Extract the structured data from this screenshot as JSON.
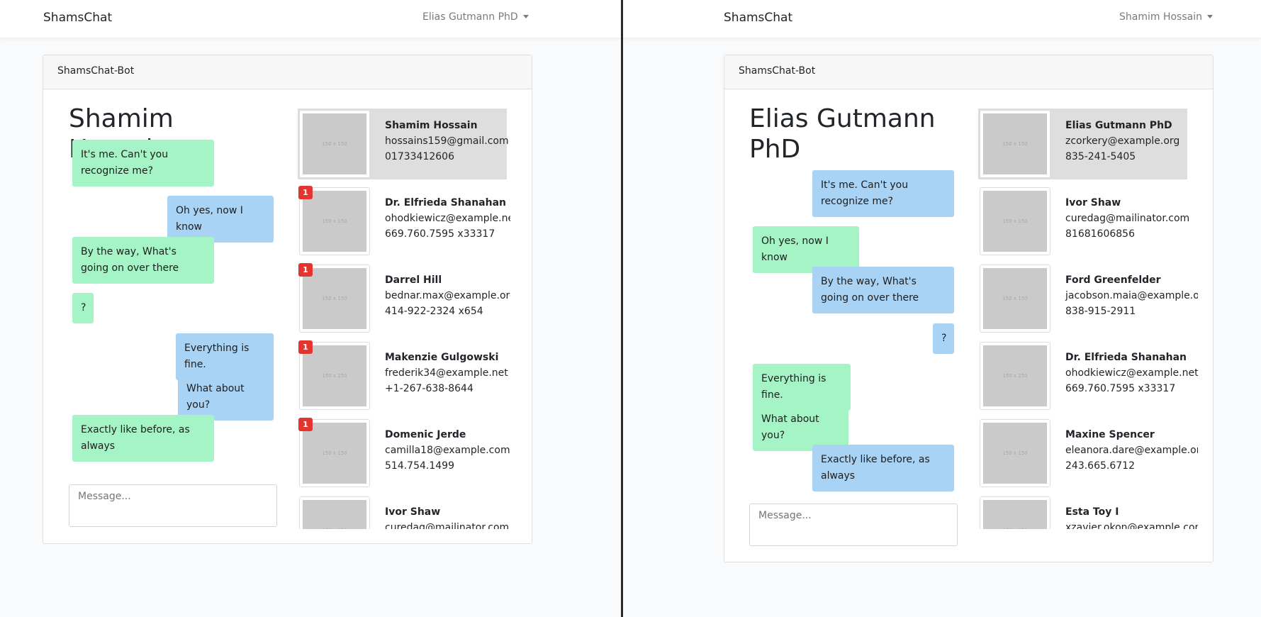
{
  "left": {
    "brand": "ShamsChat",
    "current_user": "Elias Gutmann PhD",
    "card_title": "ShamsChat-Bot",
    "chat_partner": "Shamim Hossain",
    "messages": [
      {
        "text": "It's me. Can't you recognize me?",
        "side": "left",
        "color": "green"
      },
      {
        "text": "Oh yes, now I know",
        "side": "right",
        "color": "blue"
      },
      {
        "text": "By the way, What's going on over there",
        "side": "left",
        "color": "green"
      },
      {
        "text": "?",
        "side": "left",
        "color": "green"
      },
      {
        "text": "Everything is fine.",
        "side": "right",
        "color": "blue"
      },
      {
        "text": "What about you?",
        "side": "right",
        "color": "blue"
      },
      {
        "text": "Exactly like before, as always",
        "side": "left",
        "color": "green"
      }
    ],
    "input_placeholder": "Message...",
    "thumb_label": "150 x 150",
    "contacts": [
      {
        "name": "Shamim Hossain",
        "email": "hossains159@gmail.com",
        "phone": "01733412606",
        "badge": "",
        "active": true
      },
      {
        "name": "Dr. Elfrieda Shanahan",
        "email": "ohodkiewicz@example.net",
        "phone": "669.760.7595 x33317",
        "badge": "1",
        "active": false
      },
      {
        "name": "Darrel Hill",
        "email": "bednar.max@example.org",
        "phone": "414-922-2324 x654",
        "badge": "1",
        "active": false
      },
      {
        "name": "Makenzie Gulgowski",
        "email": "frederik34@example.net",
        "phone": "+1-267-638-8644",
        "badge": "1",
        "active": false
      },
      {
        "name": "Domenic Jerde",
        "email": "camilla18@example.com",
        "phone": "514.754.1499",
        "badge": "1",
        "active": false
      },
      {
        "name": "Ivor Shaw",
        "email": "curedag@mailinator.com",
        "phone": "",
        "badge": "",
        "active": false
      }
    ]
  },
  "right": {
    "brand": "ShamsChat",
    "current_user": "Shamim Hossain",
    "card_title": "ShamsChat-Bot",
    "chat_partner": "Elias Gutmann PhD",
    "messages": [
      {
        "text": "It's me. Can't you recognize me?",
        "side": "right",
        "color": "blue"
      },
      {
        "text": "Oh yes, now I know",
        "side": "left",
        "color": "green"
      },
      {
        "text": "By the way, What's going on over there",
        "side": "right",
        "color": "blue"
      },
      {
        "text": "?",
        "side": "right",
        "color": "blue"
      },
      {
        "text": "Everything is fine.",
        "side": "left",
        "color": "green"
      },
      {
        "text": "What about you?",
        "side": "left",
        "color": "green"
      },
      {
        "text": "Exactly like before, as always",
        "side": "right",
        "color": "blue"
      }
    ],
    "input_placeholder": "Message...",
    "thumb_label": "150 x 150",
    "contacts": [
      {
        "name": "Elias Gutmann PhD",
        "email": "zcorkery@example.org",
        "phone": "835-241-5405",
        "badge": "",
        "active": true
      },
      {
        "name": "Ivor Shaw",
        "email": "curedag@mailinator.com",
        "phone": "81681606856",
        "badge": "",
        "active": false
      },
      {
        "name": "Ford Greenfelder",
        "email": "jacobson.maia@example.org",
        "phone": "838-915-2911",
        "badge": "",
        "active": false
      },
      {
        "name": "Dr. Elfrieda Shanahan",
        "email": "ohodkiewicz@example.net",
        "phone": "669.760.7595 x33317",
        "badge": "",
        "active": false
      },
      {
        "name": "Maxine Spencer",
        "email": "eleanora.dare@example.org",
        "phone": "243.665.6712",
        "badge": "",
        "active": false
      },
      {
        "name": "Esta Toy I",
        "email": "xzavier.okon@example.com",
        "phone": "",
        "badge": "",
        "active": false
      }
    ]
  },
  "colors": {
    "green_bubble": "#a4f4c5",
    "blue_bubble": "#a9d3f4",
    "badge": "#e3342f",
    "active_contact": "#dedede"
  }
}
